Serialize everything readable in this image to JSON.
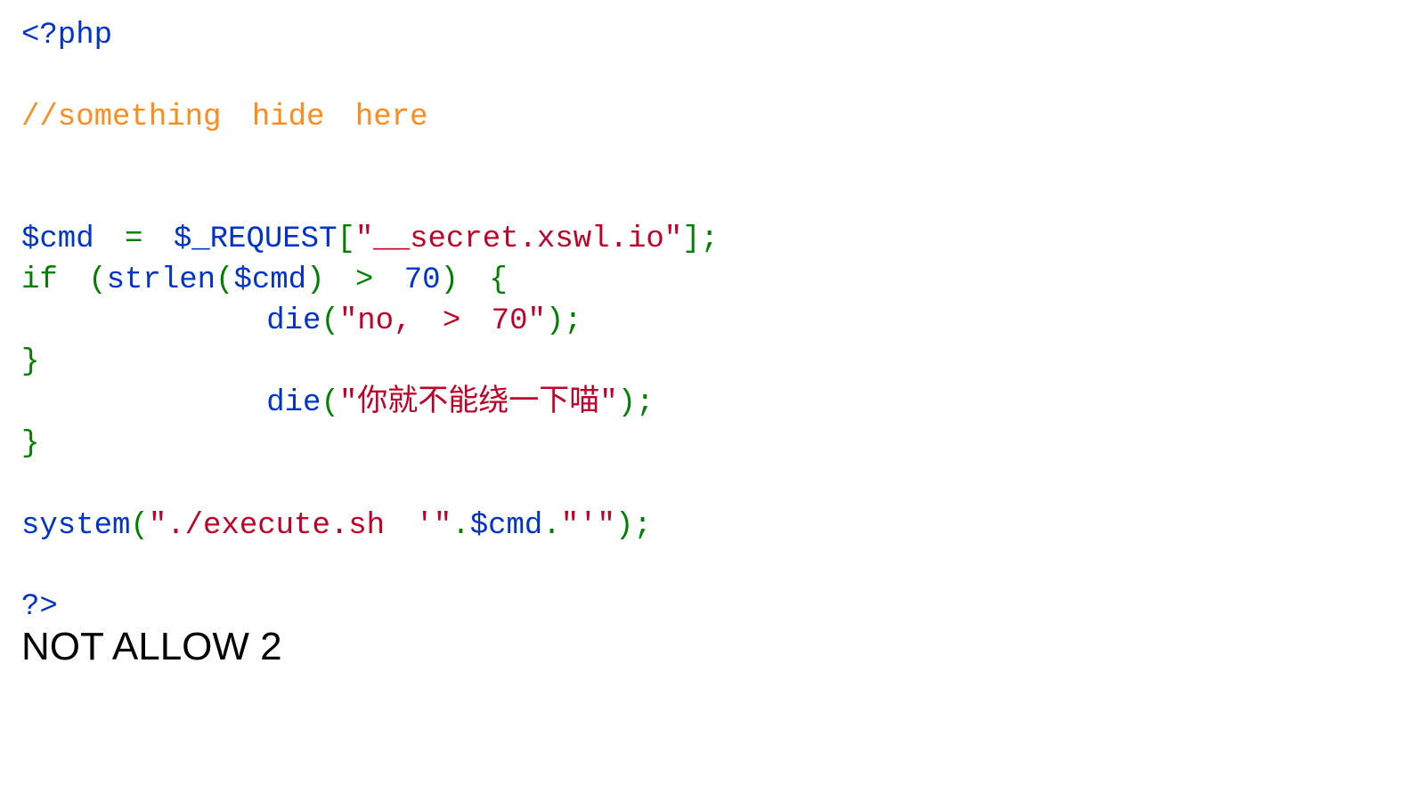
{
  "code": {
    "open_tag": "<?php",
    "comment": "//something hide here",
    "cmd_var": "$cmd",
    "assign_eq": "=",
    "request_var": "$_REQUEST",
    "lbracket": "[",
    "key_string": "\"__secret.xswl.io\"",
    "rbracket_semi": "];",
    "if_kw": "if",
    "lparen": "(",
    "strlen_fn": "strlen",
    "strlen_lparen": "(",
    "cmd_ref": "$cmd",
    "strlen_rparen": ")",
    "gt": ">",
    "seventy": "70",
    "rparen": ")",
    "lbrace": "{",
    "die1_fn": "die",
    "die1_lparen": "(",
    "die1_str": "\"no, > 70\"",
    "die1_rparen_semi": ");",
    "rbrace1": "}",
    "die2_fn": "die",
    "die2_lparen": "(",
    "die2_str": "\"你就不能绕一下喵\"",
    "die2_rparen_semi": ");",
    "rbrace2": "}",
    "system_fn": "system",
    "system_lparen": "(",
    "str_exec_a": "\"./execute.sh '\"",
    "dot1": ".",
    "cmd_ref2": "$cmd",
    "dot2": ".",
    "str_exec_b": "\"'\"",
    "system_rparen_semi": ");",
    "close_tag": "?>"
  },
  "footer_text": "NOT ALLOW 2"
}
